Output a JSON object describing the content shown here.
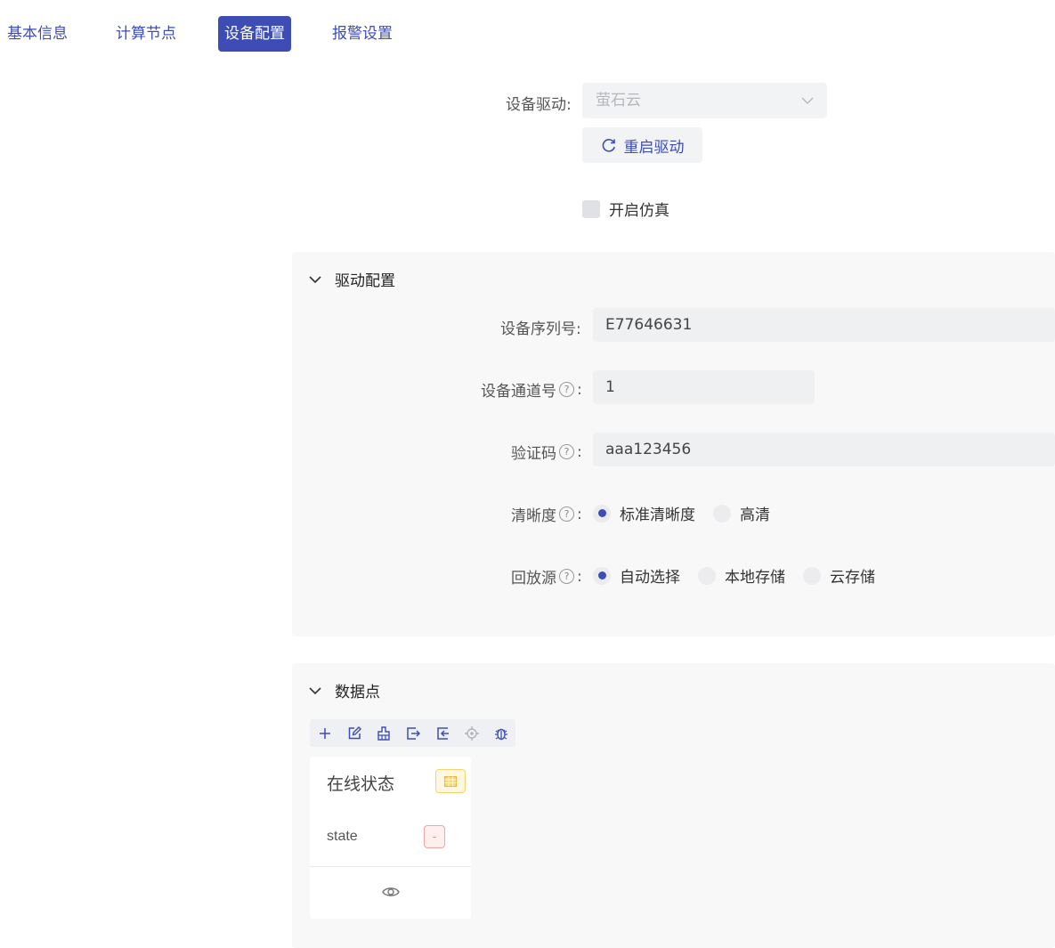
{
  "tabs": [
    {
      "label": "基本信息",
      "active": false
    },
    {
      "label": "计算节点",
      "active": false
    },
    {
      "label": "设备配置",
      "active": true
    },
    {
      "label": "报警设置",
      "active": false
    }
  ],
  "driver": {
    "label": "设备驱动:",
    "value": "萤石云",
    "restart_label": "重启驱动",
    "simulate_label": "开启仿真",
    "simulate_checked": false
  },
  "driver_config": {
    "title": "驱动配置",
    "serial_label": "设备序列号:",
    "serial_value": "E77646631",
    "channel_label": "设备通道号",
    "channel_value": "1",
    "code_label": "验证码",
    "code_value": "aaa123456",
    "clarity_label": "清晰度",
    "clarity_options": [
      "标准清晰度",
      "高清"
    ],
    "clarity_selected": "标准清晰度",
    "playback_label": "回放源",
    "playback_options": [
      "自动选择",
      "本地存储",
      "云存储"
    ],
    "playback_selected": "自动选择",
    "help_glyph": "?",
    "colon": ":"
  },
  "data_points": {
    "title": "数据点",
    "toolbar": [
      "plus-icon",
      "edit-icon",
      "clean-icon",
      "export-icon",
      "import-icon",
      "locate-icon",
      "debug-icon"
    ],
    "card": {
      "title": "在线状态",
      "key": "state",
      "value": "-"
    }
  },
  "colors": {
    "primary": "#3d4db5",
    "panel_bg": "#f8f8f8",
    "input_bg": "#eff0f2"
  }
}
